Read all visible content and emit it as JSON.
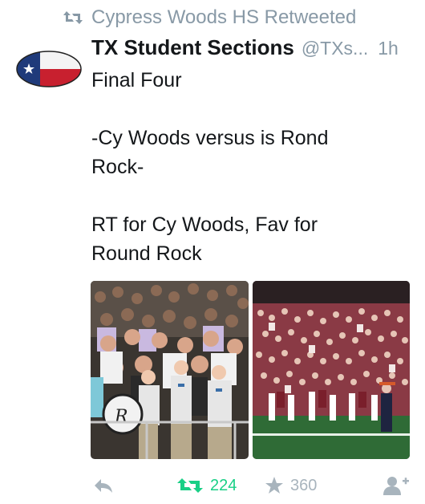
{
  "retweet_context": {
    "text": "Cypress Woods HS Retweeted",
    "icon": "retweet-icon"
  },
  "author": {
    "display_name": "TX Student Sections",
    "handle": "@TXs...",
    "time": "1h",
    "avatar_icon": "texas-football-logo"
  },
  "tweet": {
    "lines": [
      "Final Four",
      "",
      "-Cy Woods versus is Rond",
      "Rock-",
      "",
      "RT for Cy Woods, Fav for",
      "Round Rock"
    ]
  },
  "media": [
    {
      "icon": "photo-student-section-cy-woods"
    },
    {
      "icon": "photo-student-section-round-rock"
    }
  ],
  "actions": {
    "reply_icon": "reply-icon",
    "retweet_count": "224",
    "favorite_count": "360",
    "follow_icon": "follow-user-icon"
  },
  "colors": {
    "muted": "#8899a6",
    "retweet_active": "#19cf86",
    "text": "#14171a"
  }
}
